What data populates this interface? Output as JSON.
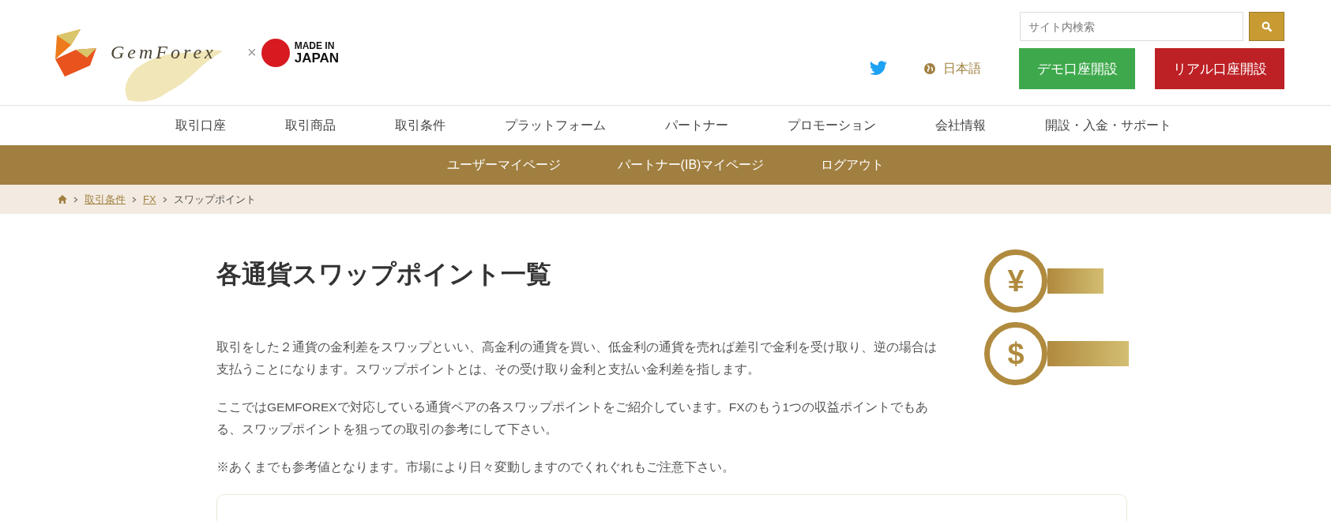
{
  "logo": {
    "brand": "GemForex",
    "cross": "×",
    "made_in": "MADE IN",
    "country": "JAPAN"
  },
  "search": {
    "placeholder": "サイト内検索"
  },
  "language": "日本語",
  "buttons": [
    {
      "label": "デモ口座開設",
      "kind": "demo"
    },
    {
      "label": "リアル口座開設",
      "kind": "real"
    }
  ],
  "main_nav": [
    "取引口座",
    "取引商品",
    "取引条件",
    "プラットフォーム",
    "パートナー",
    "プロモーション",
    "会社情報",
    "開設・入金・サポート"
  ],
  "user_nav": [
    "ユーザーマイページ",
    "パートナー(IB)マイページ",
    "ログアウト"
  ],
  "breadcrumb": {
    "links": [
      "取引条件",
      "FX"
    ],
    "current": "スワップポイント"
  },
  "title": "各通貨スワップポイント一覧",
  "paragraphs": [
    "取引をした２通貨の金利差をスワップといい、高金利の通貨を買い、低金利の通貨を売れば差引で金利を受け取り、逆の場合は支払うことになります。スワップポイントとは、その受け取り金利と支払い金利差を指します。",
    "ここではGEMFOREXで対応している通貨ペアの各スワップポイントをご紹介しています。FXのもう1つの収益ポイントでもある、スワップポイントを狙っての取引の参考にして下さい。",
    "※あくまでも参考値となります。市場により日々変動しますのでくれぐれもご注意下さい。"
  ],
  "illustration": {
    "symbols": [
      "¥",
      "$"
    ]
  }
}
